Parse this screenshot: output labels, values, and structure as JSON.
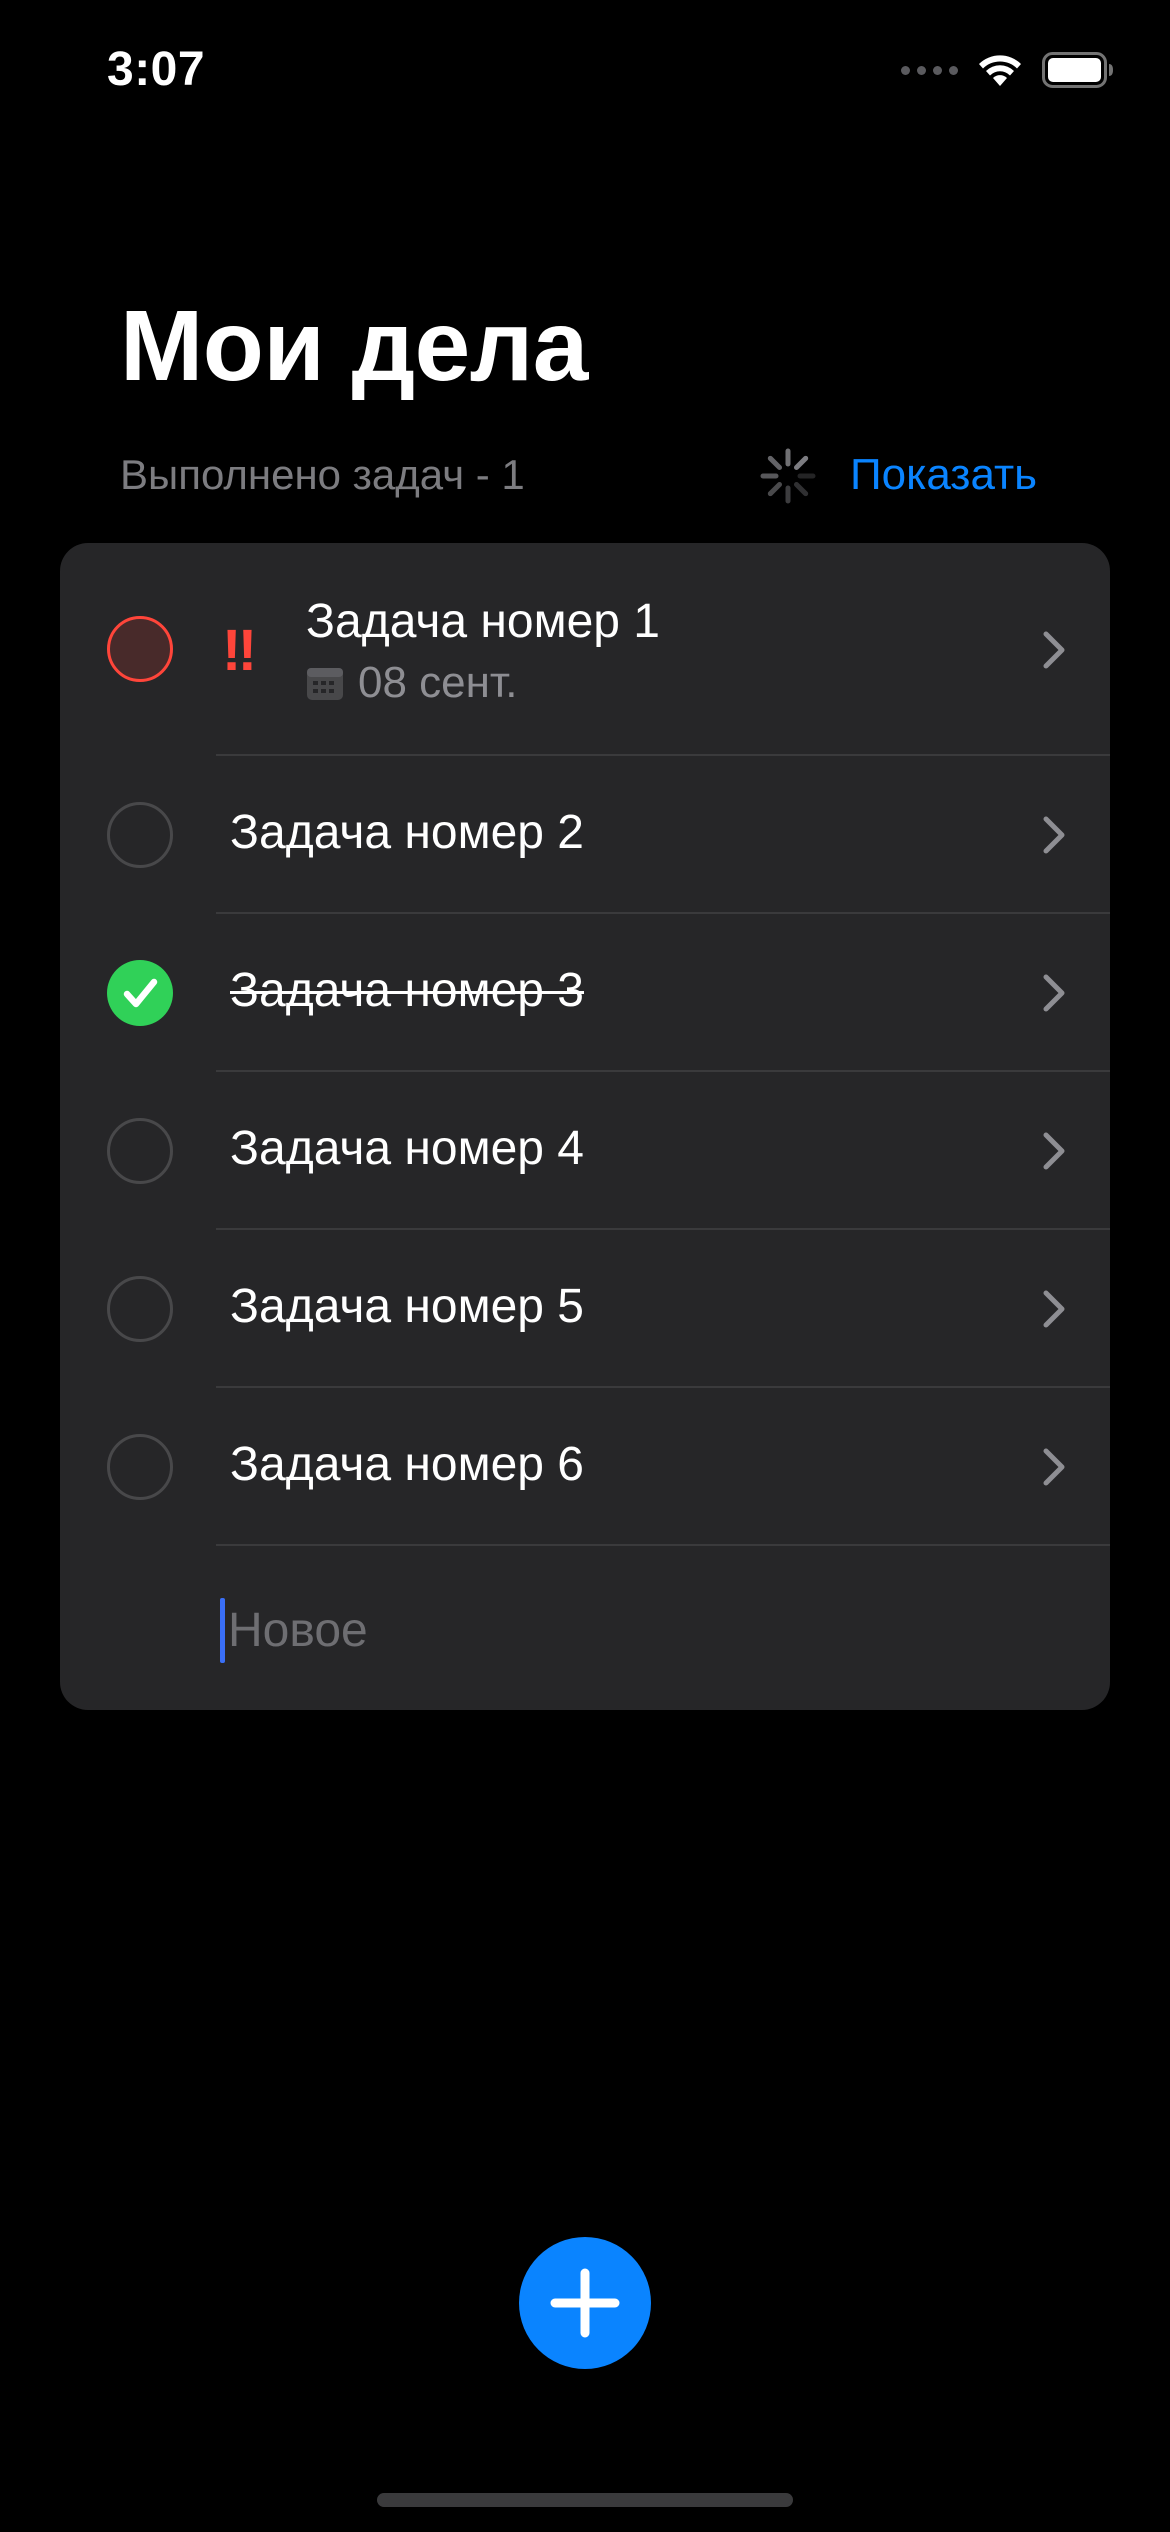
{
  "status_bar": {
    "time": "3:07",
    "icons": [
      "signal-dots-icon",
      "wifi-icon",
      "battery-icon"
    ]
  },
  "header": {
    "title": "Мои дела",
    "completed_text": "Выполнено задач - 1",
    "show_button_label": "Показать"
  },
  "tasks": [
    {
      "title": "Задача номер 1",
      "done": false,
      "priority": "high",
      "priority_mark": "‼",
      "deadline": "08 сент."
    },
    {
      "title": "Задача номер 2",
      "done": false
    },
    {
      "title": "Задача номер 3",
      "done": true
    },
    {
      "title": "Задача номер 4",
      "done": false
    },
    {
      "title": "Задача номер 5",
      "done": false
    },
    {
      "title": "Задача номер 6",
      "done": false
    }
  ],
  "new_task": {
    "placeholder": "Новое",
    "value": ""
  },
  "colors": {
    "background": "#000000",
    "card": "#262628",
    "accent": "#0a84ff",
    "done": "#30d158",
    "priority": "#ff453a",
    "secondary_text": "#8e8e93"
  }
}
